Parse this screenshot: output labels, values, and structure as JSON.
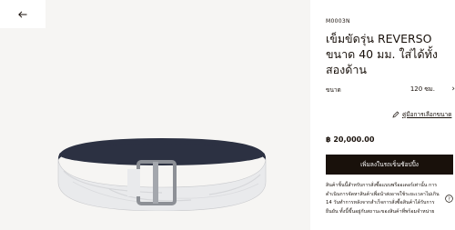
{
  "nav": {
    "back_icon": "arrow-left-icon"
  },
  "product": {
    "sku": "M0003N",
    "title": "เข็มขัดรุ่น REVERSO ขนาด 40 มม. ใส่ได้ทั้งสองด้าน",
    "size_label": "ขนาด",
    "size_value": "120 ซม.",
    "size_chevron_icon": "chevron-right-icon",
    "size_guide_icon": "ruler-pencil-icon",
    "size_guide_link": "คู่มือการเลือกขนาด",
    "price": "฿ 20,000.00",
    "cta_label": "เพิ่มลงในรถเข็นช้อปปิ้ง",
    "note": "สินค้าชิ้นนี้สำหรับการสั่งซื้อแบบพรีออเดอร์เท่านั้น การดำเนินการจัดหาสินค้าเพื่อนำส่งอาจใช้ระยะเวลาไม่เกิน 14 วันทำการหลังจากสำเร็จการสั่งซื้อสินค้าได้รับการยืนยัน ทั้งนี้ขึ้นอยู่กับสถานะของสินค้าที่พร้อมจำหน่าย",
    "help_icon": "help-circle-icon"
  },
  "colors": {
    "ink": "#19110b",
    "gallery_bg": "#f6f5f3",
    "belt_inner": "#2c3142",
    "belt_outer": "#e9eaec",
    "buckle": "#8d9096"
  }
}
